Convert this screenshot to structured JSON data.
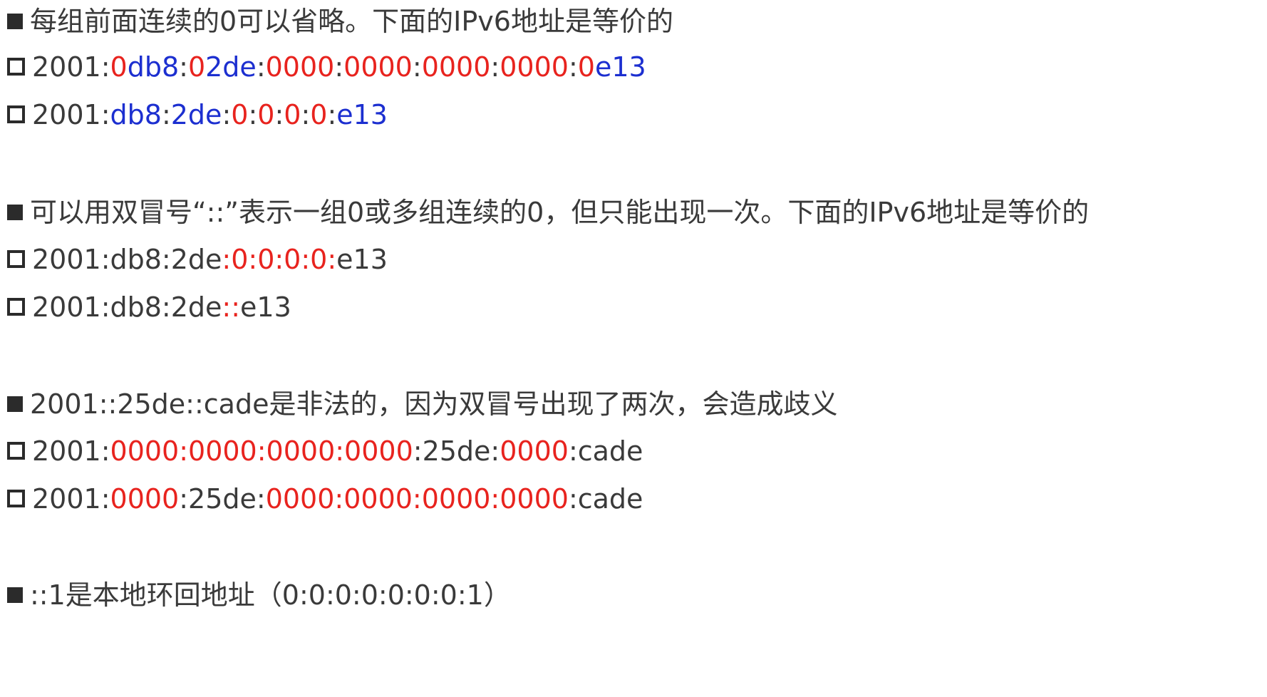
{
  "colors": {
    "red": "#e8231e",
    "blue": "#1c2fd0",
    "text": "#3a3a3a"
  },
  "lines": [
    {
      "bullet": "filled",
      "segments": [
        {
          "t": "每组前面连续的0可以省略。下面的IPv6地址是等价的",
          "c": "dark"
        }
      ]
    },
    {
      "bullet": "hollow",
      "segments": [
        {
          "t": "2001:",
          "c": "dark"
        },
        {
          "t": "0",
          "c": "red"
        },
        {
          "t": "db8",
          "c": "blue"
        },
        {
          "t": ":",
          "c": "dark"
        },
        {
          "t": "0",
          "c": "red"
        },
        {
          "t": "2de",
          "c": "blue"
        },
        {
          "t": ":",
          "c": "dark"
        },
        {
          "t": "0000",
          "c": "red"
        },
        {
          "t": ":",
          "c": "dark"
        },
        {
          "t": "0000",
          "c": "red"
        },
        {
          "t": ":",
          "c": "dark"
        },
        {
          "t": "0000",
          "c": "red"
        },
        {
          "t": ":",
          "c": "dark"
        },
        {
          "t": "0000",
          "c": "red"
        },
        {
          "t": ":",
          "c": "dark"
        },
        {
          "t": "0",
          "c": "red"
        },
        {
          "t": "e13",
          "c": "blue"
        }
      ]
    },
    {
      "bullet": "hollow",
      "segments": [
        {
          "t": "2001:",
          "c": "dark"
        },
        {
          "t": "db8",
          "c": "blue"
        },
        {
          "t": ":",
          "c": "dark"
        },
        {
          "t": "2de",
          "c": "blue"
        },
        {
          "t": ":",
          "c": "dark"
        },
        {
          "t": "0",
          "c": "red"
        },
        {
          "t": ":",
          "c": "dark"
        },
        {
          "t": "0",
          "c": "red"
        },
        {
          "t": ":",
          "c": "dark"
        },
        {
          "t": "0",
          "c": "red"
        },
        {
          "t": ":",
          "c": "dark"
        },
        {
          "t": "0",
          "c": "red"
        },
        {
          "t": ":",
          "c": "dark"
        },
        {
          "t": "e13",
          "c": "blue"
        }
      ]
    },
    {
      "bullet": "filled",
      "segments": [
        {
          "t": "可以用双冒号“::”表示一组0或多组连续的0，但只能出现一次。下面的IPv6地址是等价的",
          "c": "dark"
        }
      ]
    },
    {
      "bullet": "hollow",
      "segments": [
        {
          "t": "2001:db8:2de",
          "c": "dark"
        },
        {
          "t": ":0:0:0:0:",
          "c": "red"
        },
        {
          "t": "e13",
          "c": "dark"
        }
      ]
    },
    {
      "bullet": "hollow",
      "segments": [
        {
          "t": "2001:db8:2de",
          "c": "dark"
        },
        {
          "t": "::",
          "c": "red"
        },
        {
          "t": "e13",
          "c": "dark"
        }
      ]
    },
    {
      "bullet": "filled",
      "segments": [
        {
          "t": "2001::25de::cade是非法的，因为双冒号出现了两次，会造成歧义",
          "c": "dark"
        }
      ]
    },
    {
      "bullet": "hollow",
      "segments": [
        {
          "t": "2001:",
          "c": "dark"
        },
        {
          "t": "0000:0000:0000:0000",
          "c": "red"
        },
        {
          "t": ":25de:",
          "c": "dark"
        },
        {
          "t": "0000",
          "c": "red"
        },
        {
          "t": ":cade",
          "c": "dark"
        }
      ]
    },
    {
      "bullet": "hollow",
      "segments": [
        {
          "t": "2001:",
          "c": "dark"
        },
        {
          "t": "0000",
          "c": "red"
        },
        {
          "t": ":25de:",
          "c": "dark"
        },
        {
          "t": "0000:0000:0000:0000",
          "c": "red"
        },
        {
          "t": ":cade",
          "c": "dark"
        }
      ]
    },
    {
      "bullet": "filled",
      "segments": [
        {
          "t": "::1是本地环回地址（0:0:0:0:0:0:0:1）",
          "c": "dark"
        }
      ]
    }
  ]
}
